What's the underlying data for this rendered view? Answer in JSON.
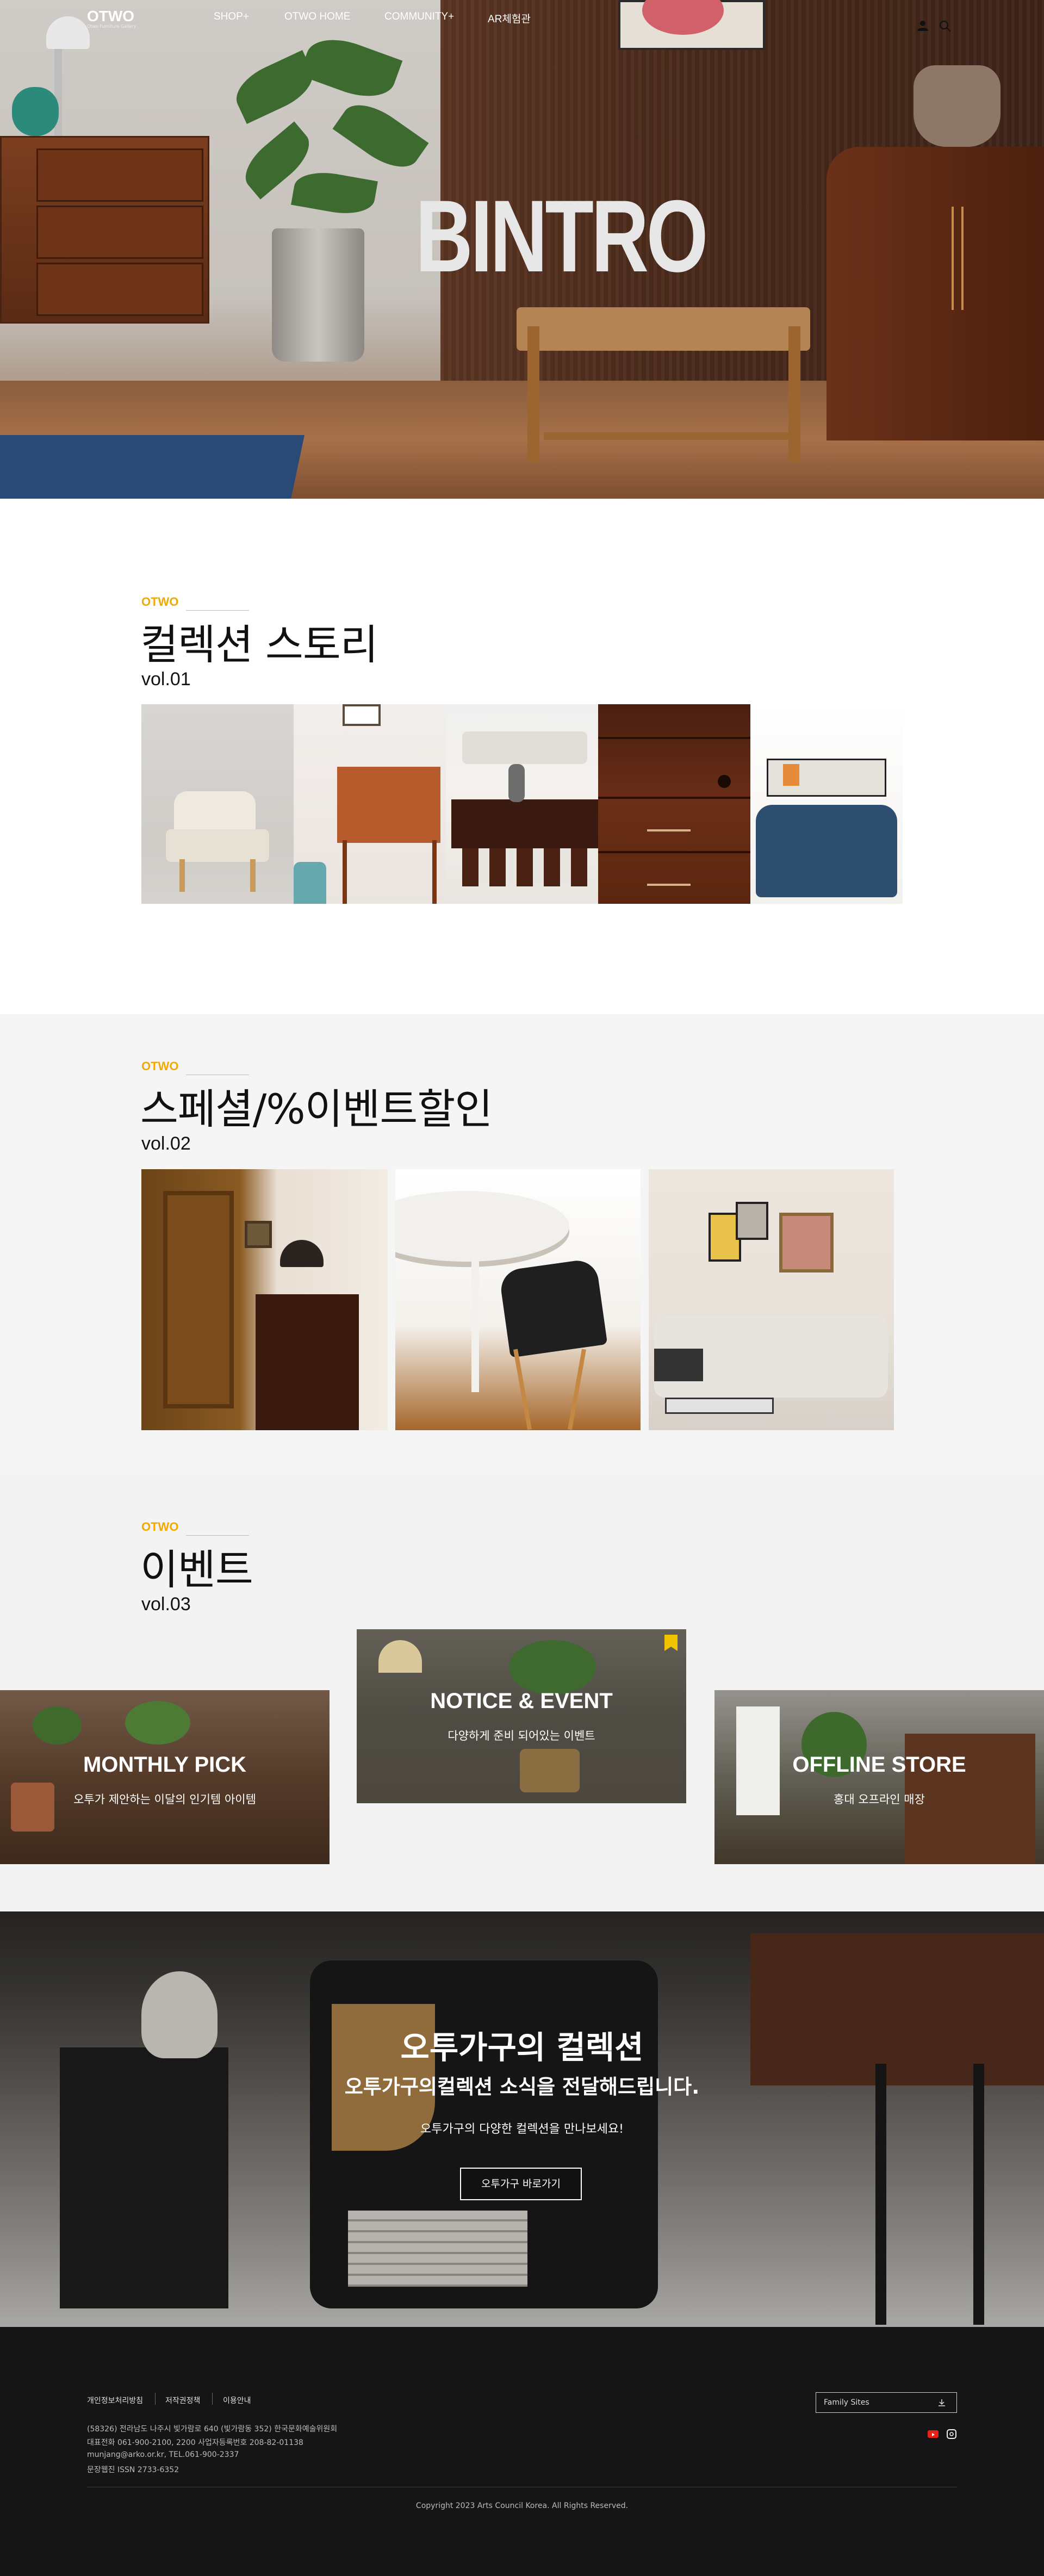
{
  "nav": {
    "logo": "OTWO",
    "logo_sub": "Otwo Furniture Gallery",
    "items": [
      "SHOP+",
      "OTWO HOME",
      "COMMUNITY+",
      "AR체험관"
    ]
  },
  "hero": {
    "title": "BINTRO"
  },
  "sections": [
    {
      "brand": "OTWO",
      "title": "컬렉션 스토리",
      "vol": "vol.01"
    },
    {
      "brand": "OTWO",
      "title": "스페셜/%이벤트할인",
      "vol": "vol.02"
    },
    {
      "brand": "OTWO",
      "title": "이벤트",
      "vol": "vol.03"
    }
  ],
  "events": [
    {
      "title": "MONTHLY PICK",
      "sub": "오투가 제안하는 이달의 인기템 아이템"
    },
    {
      "title": "NOTICE & EVENT",
      "sub": "다양하게 준비 되어있는 이벤트"
    },
    {
      "title": "OFFLINE STORE",
      "sub": "홍대 오프라인 매장"
    }
  ],
  "banner": {
    "title": "오투가구의 컬렉션",
    "sub": "오투가구의컬렉션 소식을 전달해드립니다.",
    "desc": "오투가구의 다양한 컬렉션을 만나보세요!",
    "button": "오투가구 바로가기"
  },
  "footer": {
    "links": [
      "개인정보처리방침",
      "저작권정책",
      "이용안내"
    ],
    "info": [
      "(58326) 전라남도 나주시 빛가람로 640 (빛가람동 352) 한국문화예술위원회",
      "대표전화 061-900-2100, 2200 사업자등록번호 208-82-01138",
      "munjang@arko.or.kr, TEL.061-900-2337",
      "문장웹진 ISSN 2733-6352"
    ],
    "family_sites": "Family Sites",
    "copyright": "Copyright 2023 Arts Council Korea. All Rights Reserved."
  },
  "colors": {
    "accent": "#f2a900",
    "footer_bg": "#151515",
    "section_bg": "#f5f5f5"
  },
  "icons": [
    "user-icon",
    "search-icon",
    "bookmark-icon",
    "download-icon",
    "youtube-icon",
    "instagram-icon"
  ]
}
